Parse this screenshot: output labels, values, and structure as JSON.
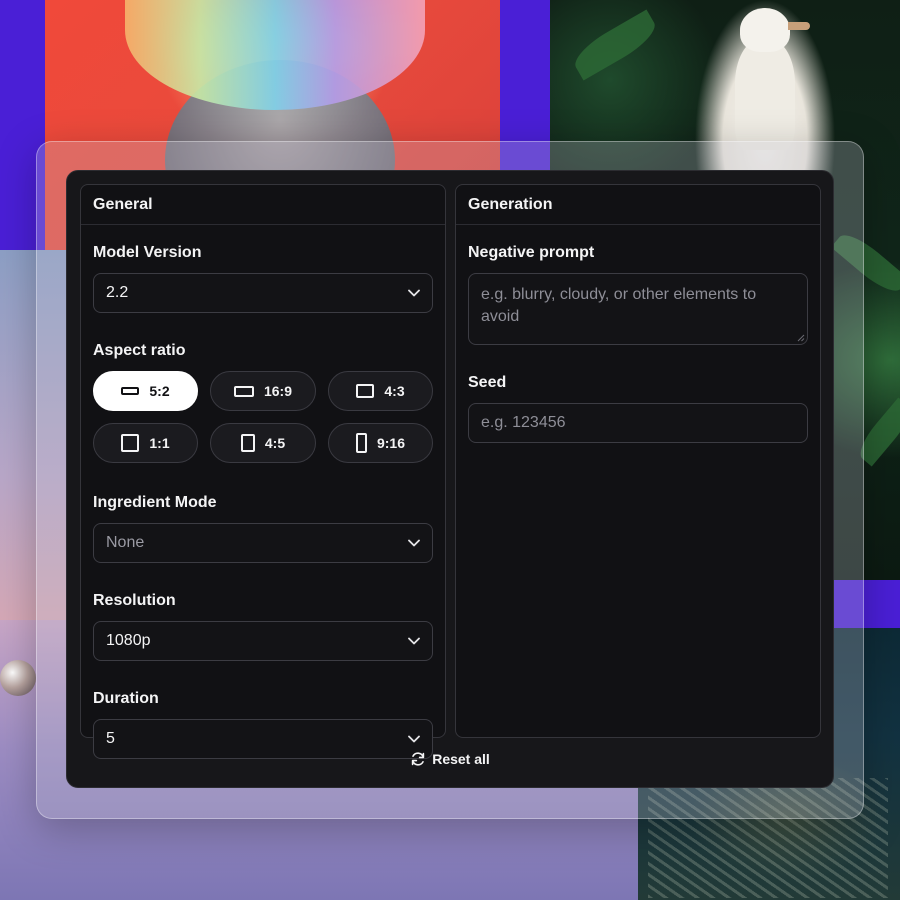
{
  "general": {
    "title": "General",
    "model_version": {
      "label": "Model Version",
      "value": "2.2"
    },
    "aspect_ratio": {
      "label": "Aspect ratio",
      "selected": "5:2",
      "options": [
        "5:2",
        "16:9",
        "4:3",
        "1:1",
        "4:5",
        "9:16"
      ]
    },
    "ingredient_mode": {
      "label": "Ingredient Mode",
      "value": "None"
    },
    "resolution": {
      "label": "Resolution",
      "value": "1080p"
    },
    "duration": {
      "label": "Duration",
      "value": "5"
    }
  },
  "generation": {
    "title": "Generation",
    "negative_prompt": {
      "label": "Negative prompt",
      "placeholder": "e.g. blurry, cloudy, or other elements to avoid"
    },
    "seed": {
      "label": "Seed",
      "placeholder": "e.g. 123456"
    }
  },
  "footer": {
    "reset_label": "Reset all"
  },
  "icons": {
    "select": "chevron-down-icon",
    "reset": "refresh-icon",
    "aspect": "aspect-ratio-shape-icon"
  },
  "colors": {
    "panel_bg": "#17171a",
    "card_bg": "#111114",
    "border": "#3c3c43",
    "text": "#f4f4f5",
    "placeholder": "#8e8e97",
    "active_chip": "#ffffff"
  }
}
